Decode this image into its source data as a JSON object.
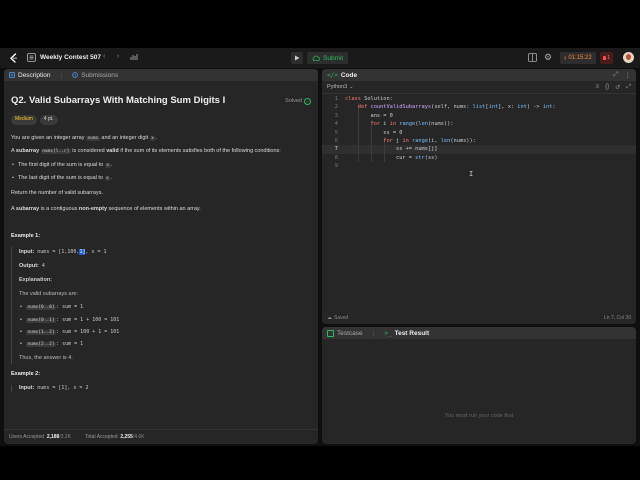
{
  "topbar": {
    "contest_title": "Weekly Contest 507",
    "run_label": "",
    "submit_label": "Submit",
    "timer": "01:15:22",
    "notification_count": "1"
  },
  "left_tabs": {
    "description": "Description",
    "submissions": "Submissions"
  },
  "problem": {
    "title": "Q2. Valid Subarrays With Matching Sum Digits I",
    "status": "Solved",
    "difficulty": "Medium",
    "points": "4 pt.",
    "p1_a": "You are given an integer array ",
    "p1_nums": "nums",
    "p1_b": " and an integer digit ",
    "p1_x": "x",
    "p1_c": ".",
    "p2_a": "A ",
    "p2_subarray": "subarray",
    "p2_code": "nums[l..r]",
    "p2_b": " is considered ",
    "p2_valid": "valid",
    "p2_c": " if the sum of its elements satisfies both of the following conditions:",
    "cond1_a": "The first digit of the sum is equal to ",
    "cond2_a": "The last digit of the sum is equal to ",
    "cond_x": "x",
    "cond_end": ".",
    "p3": "Return the number of valid subarrays.",
    "p4_a": "A ",
    "p4_subarray": "subarray",
    "p4_b": " is a contiguous ",
    "p4_nonempty": "non-empty",
    "p4_c": " sequence of elements within an array.",
    "ex1_title": "Example 1:",
    "ex1_input_label": "Input:",
    "ex1_input_a": " nums = [1,100,",
    "ex1_input_sel": "1]",
    "ex1_input_b": ", x = 1",
    "ex1_output_label": "Output:",
    "ex1_output": " 4",
    "ex1_expl_label": "Explanation:",
    "ex1_expl_intro": "The valid subarrays are:",
    "ex1_items": [
      {
        "code": "nums[0..0]",
        "text": ": sum = 1"
      },
      {
        "code": "nums[0..1]",
        "text": ": sum = 1 + 100 = 101"
      },
      {
        "code": "nums[1..2]",
        "text": ": sum = 100 + 1 = 101"
      },
      {
        "code": "nums[2..2]",
        "text": ": sum = 1"
      }
    ],
    "ex1_answer": "Thus, the answer is 4.",
    "ex2_title": "Example 2:",
    "ex2_input_label": "Input:",
    "ex2_input": " nums = [1], x = 2"
  },
  "stats": {
    "users_label": "Users Accepted",
    "users_value": "2,188",
    "users_total": "/3.2K",
    "total_label": "Total Accepted",
    "total_value": "2,255",
    "total_total": "/4.6K"
  },
  "code_panel": {
    "title": "Code",
    "language": "Python3",
    "status": "Saved",
    "cursor": "Ln 7, Col 30",
    "lines": [
      {
        "num": "1",
        "indent": "",
        "tokens": [
          {
            "t": "class ",
            "c": "kw"
          },
          {
            "t": "Solution:",
            "c": "tx"
          }
        ]
      },
      {
        "num": "2",
        "indent": "    ",
        "tokens": [
          {
            "t": "def ",
            "c": "kw"
          },
          {
            "t": "countValidSubarrays",
            "c": "fn"
          },
          {
            "t": "(self, nums: ",
            "c": "tx"
          },
          {
            "t": "list",
            "c": "bi"
          },
          {
            "t": "[",
            "c": "tx"
          },
          {
            "t": "int",
            "c": "bi"
          },
          {
            "t": "], x: ",
            "c": "tx"
          },
          {
            "t": "int",
            "c": "bi"
          },
          {
            "t": ") -> ",
            "c": "tx"
          },
          {
            "t": "int",
            "c": "bi"
          },
          {
            "t": ":",
            "c": "tx"
          }
        ]
      },
      {
        "num": "3",
        "indent": "        ",
        "tokens": [
          {
            "t": "ans = 0",
            "c": "tx"
          }
        ]
      },
      {
        "num": "4",
        "indent": "        ",
        "tokens": [
          {
            "t": "for ",
            "c": "kw"
          },
          {
            "t": "i ",
            "c": "tx"
          },
          {
            "t": "in ",
            "c": "kw"
          },
          {
            "t": "range",
            "c": "bi"
          },
          {
            "t": "(",
            "c": "tx"
          },
          {
            "t": "len",
            "c": "bi"
          },
          {
            "t": "(nums)):",
            "c": "tx"
          }
        ]
      },
      {
        "num": "5",
        "indent": "            ",
        "tokens": [
          {
            "t": "ss = 0",
            "c": "tx"
          }
        ]
      },
      {
        "num": "6",
        "indent": "            ",
        "tokens": [
          {
            "t": "for ",
            "c": "kw"
          },
          {
            "t": "j ",
            "c": "tx"
          },
          {
            "t": "in ",
            "c": "kw"
          },
          {
            "t": "range",
            "c": "bi"
          },
          {
            "t": "(i, ",
            "c": "tx"
          },
          {
            "t": "len",
            "c": "bi"
          },
          {
            "t": "(nums)):",
            "c": "tx"
          }
        ]
      },
      {
        "num": "7",
        "indent": "                ",
        "tokens": [
          {
            "t": "ss += nums[j]",
            "c": "tx"
          }
        ]
      },
      {
        "num": "8",
        "indent": "                ",
        "tokens": [
          {
            "t": "cur = ",
            "c": "tx"
          },
          {
            "t": "str",
            "c": "bi"
          },
          {
            "t": "(ss)",
            "c": "tx"
          }
        ]
      },
      {
        "num": "9",
        "indent": "",
        "tokens": []
      }
    ]
  },
  "result_panel": {
    "testcase_tab": "Testcase",
    "result_tab": "Test Result",
    "message": "You must run your code first"
  },
  "colors": {
    "accent_green": "#2cbb5d",
    "medium": "#ffc01e",
    "timer": "#ff8a3d"
  }
}
